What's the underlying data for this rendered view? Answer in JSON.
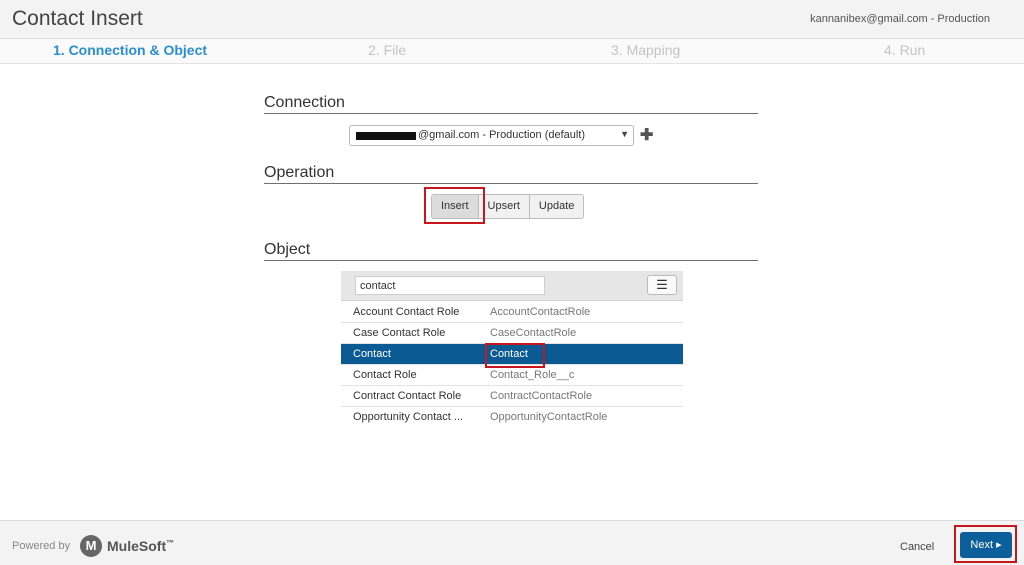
{
  "header": {
    "title": "Contact Insert",
    "account": "kannanibex@gmail.com - Production"
  },
  "steps": [
    {
      "label": "1. Connection & Object",
      "active": true
    },
    {
      "label": "2. File",
      "active": false
    },
    {
      "label": "3. Mapping",
      "active": false
    },
    {
      "label": "4. Run",
      "active": false
    }
  ],
  "connection": {
    "section_title": "Connection",
    "selected_value": "@gmail.com - Production (default)",
    "dropdown_icon": "caret-down-icon",
    "add_icon": "plus-icon"
  },
  "operation": {
    "section_title": "Operation",
    "options": [
      "Insert",
      "Upsert",
      "Update"
    ],
    "selected": "Insert"
  },
  "object": {
    "section_title": "Object",
    "search_value": "contact",
    "list_toggle_icon": "list-icon",
    "rows": [
      {
        "label": "Account Contact Role",
        "api_name": "AccountContactRole"
      },
      {
        "label": "Case Contact Role",
        "api_name": "CaseContactRole"
      },
      {
        "label": "Contact",
        "api_name": "Contact"
      },
      {
        "label": "Contact Role",
        "api_name": "Contact_Role__c"
      },
      {
        "label": "Contract Contact Role",
        "api_name": "ContractContactRole"
      },
      {
        "label": "Opportunity Contact ...",
        "api_name": "OpportunityContactRole"
      }
    ],
    "selected_index": 2
  },
  "footer": {
    "powered_by": "Powered by",
    "brand_name": "MuleSoft",
    "brand_mark": "M",
    "brand_tm": "™",
    "cancel_label": "Cancel",
    "next_label": "Next",
    "next_icon": "caret-right-icon"
  },
  "colors": {
    "active_step": "#2a8ed0",
    "selected_row": "#0c5a94",
    "next_button": "#0d5f9c",
    "annotation_red": "#c8161e"
  }
}
